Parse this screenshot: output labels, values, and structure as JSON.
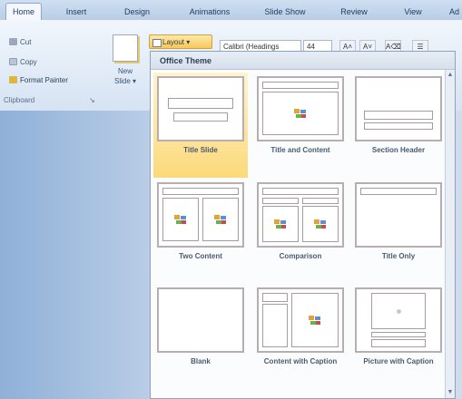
{
  "tabs": [
    "Home",
    "Insert",
    "Design",
    "Animations",
    "Slide Show",
    "Review",
    "View",
    "Ad"
  ],
  "ribbon": {
    "cut": "Cut",
    "copy": "Copy",
    "format_painter": "Format Painter",
    "clipboard": "Clipboard",
    "new_slide_line1": "New",
    "new_slide_line2": "Slide",
    "layout": "Layout",
    "font_name": "Calibri (Headings",
    "font_size": "44"
  },
  "gallery": {
    "header": "Office Theme",
    "items": [
      {
        "label": "Title Slide"
      },
      {
        "label": "Title and Content"
      },
      {
        "label": "Section Header"
      },
      {
        "label": "Two Content"
      },
      {
        "label": "Comparison"
      },
      {
        "label": "Title Only"
      },
      {
        "label": "Blank"
      },
      {
        "label": "Content with Caption"
      },
      {
        "label": "Picture with Caption"
      }
    ]
  },
  "colors": {
    "selected_item": "#fcd97a",
    "layout_button": "#f7c85a",
    "ribbon": "#d6e3f3"
  }
}
